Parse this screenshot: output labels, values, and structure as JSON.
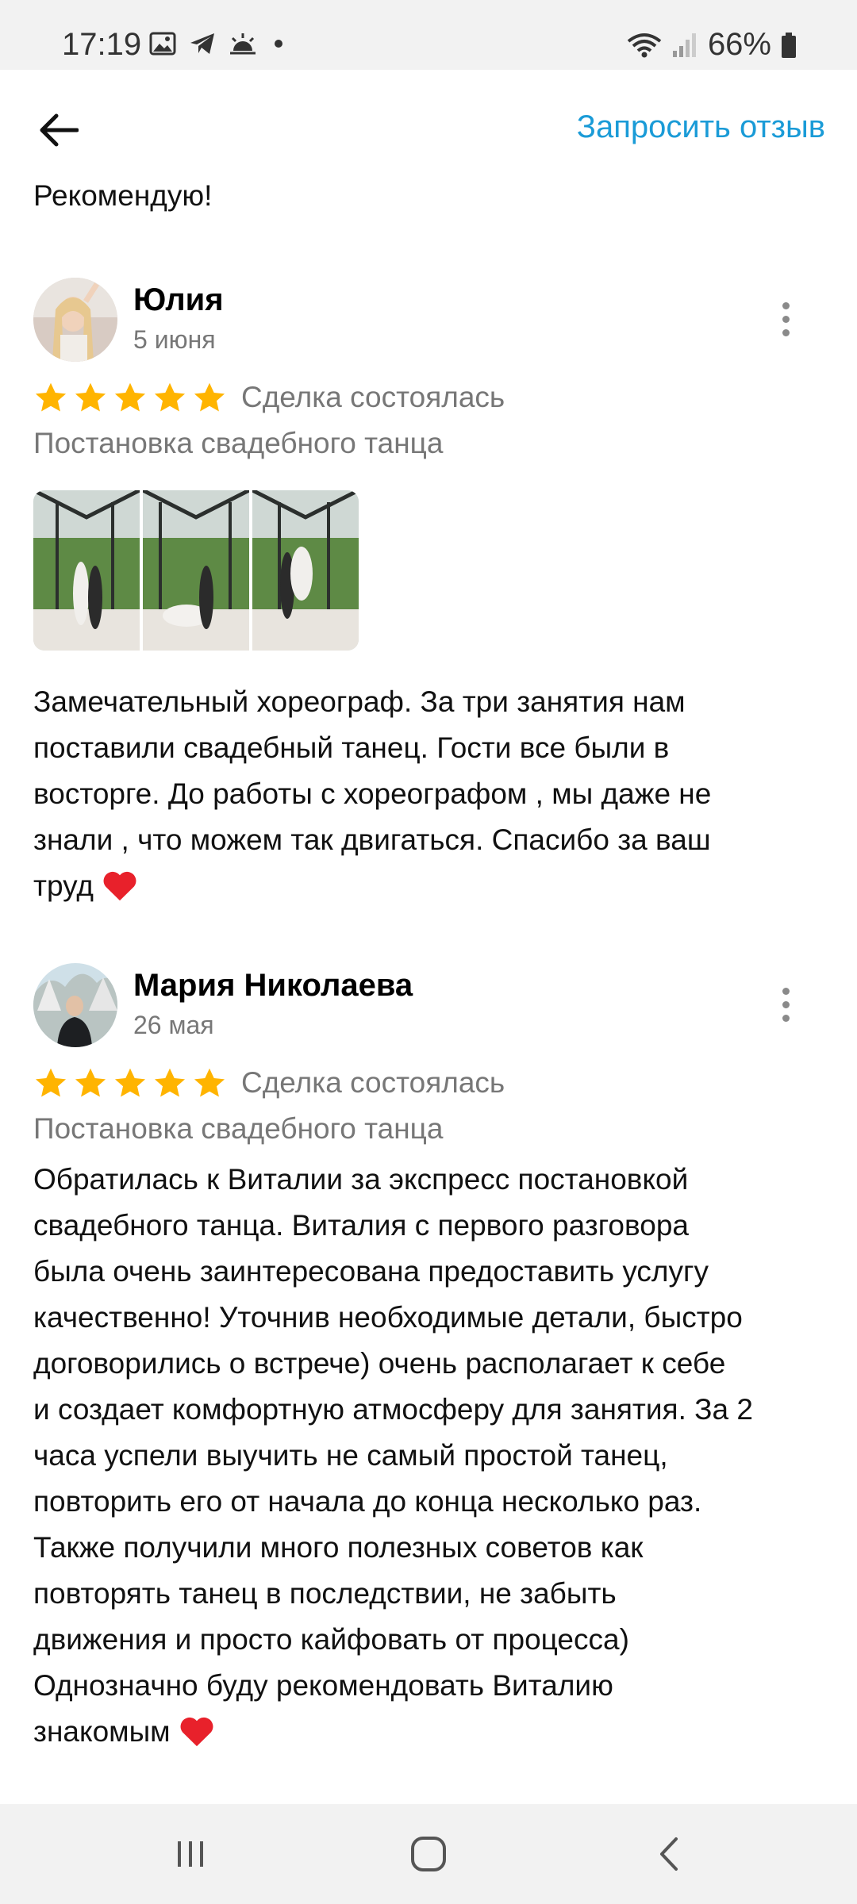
{
  "status_bar": {
    "time": "17:19",
    "battery": "66%",
    "icons": [
      "gallery-icon",
      "telegram-icon",
      "weather-icon",
      "dot-icon",
      "wifi-icon",
      "signal-icon",
      "battery-icon"
    ]
  },
  "header": {
    "back_icon": "arrow-left-icon",
    "request_review_label": "Запросить отзыв"
  },
  "previous_review_tail": "Рекомендую!",
  "reviews": [
    {
      "name": "Юлия",
      "date": "5 июня",
      "rating": 5,
      "deal_status": "Сделка состоялась",
      "service": "Постановка свадебного танца",
      "photos_count": 3,
      "lines": [
        "Замечательный хореограф. За три занятия нам",
        "поставили свадебный танец. Гости все были в",
        "восторге. До работы с хореографом , мы даже не",
        "знали , что можем так двигаться. Спасибо за ваш",
        "труд"
      ]
    },
    {
      "name": "Мария Николаева",
      "date": "26 мая",
      "rating": 5,
      "deal_status": "Сделка состоялась",
      "service": "Постановка свадебного танца",
      "lines": [
        "Обратилась к Виталии за экспресс постановкой",
        "свадебного танца. Виталия с первого разговора",
        "была очень заинтересована предоставить услугу",
        "качественно! Уточнив необходимые детали, быстро",
        "договорились о встрече) очень располагает к себе",
        "и создает комфортную атмосферу для занятия.  За 2",
        "часа успели выучить не самый простой танец,",
        "повторить его от начала до конца несколько раз.",
        "Также получили много полезных советов как",
        "повторять танец в последствии, не забыть",
        "движения и просто кайфовать от процесса)",
        "Однозначно буду рекомендовать Виталию",
        "знакомым"
      ]
    }
  ],
  "colors": {
    "accent_link": "#1a9bd7",
    "star": "#ffb400",
    "heart": "#e8212b",
    "secondary_text": "#777777"
  },
  "nav_bar": {
    "icons": [
      "recents-icon",
      "home-icon",
      "back-nav-icon"
    ]
  }
}
